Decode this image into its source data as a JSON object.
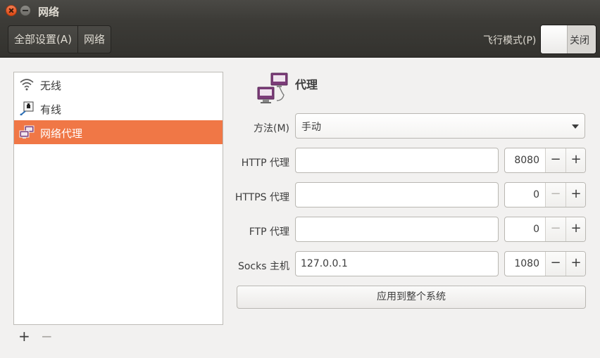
{
  "window": {
    "title": "网络"
  },
  "toolbar": {
    "crumbs": [
      "全部设置(A)",
      "网络"
    ],
    "airplane_label": "飞行模式(P)",
    "airplane_state": "关闭"
  },
  "sidebar": {
    "items": [
      {
        "label": "无线",
        "icon": "wifi-icon",
        "selected": false
      },
      {
        "label": "有线",
        "icon": "wired-network-icon",
        "selected": false
      },
      {
        "label": "网络代理",
        "icon": "network-proxy-icon",
        "selected": true
      }
    ],
    "add_label": "+",
    "remove_label": "−"
  },
  "panel": {
    "title": "代理",
    "method_label": "方法(M)",
    "method_value": "手动",
    "http_label": "HTTP 代理",
    "http_host": "",
    "http_port": "8080",
    "https_label": "HTTPS 代理",
    "https_host": "",
    "https_port": "0",
    "ftp_label": "FTP 代理",
    "ftp_host": "",
    "ftp_port": "0",
    "socks_label": "Socks 主机",
    "socks_host": "127.0.0.1",
    "socks_port": "1080",
    "minus": "−",
    "plus": "+",
    "apply_label": "应用到整个系统"
  },
  "colors": {
    "accent": "#f07746",
    "titlebar": "#3c3b37",
    "background": "#f2f1f0"
  }
}
